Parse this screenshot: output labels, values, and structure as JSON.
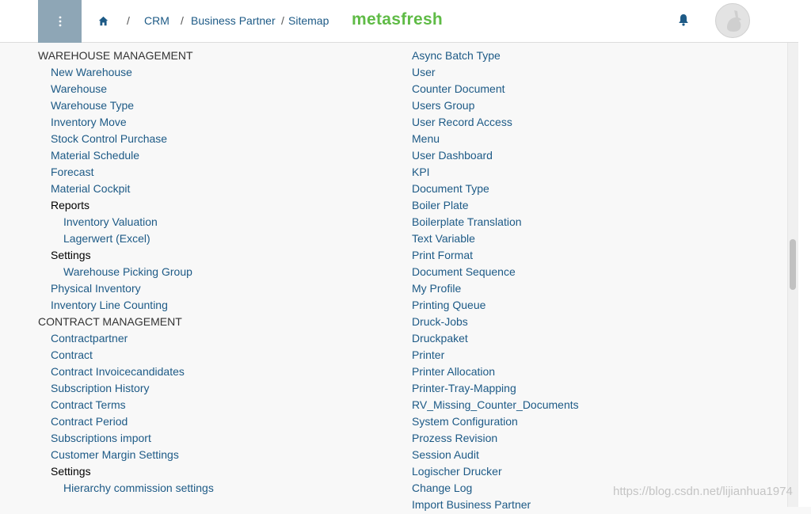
{
  "header": {
    "breadcrumb": [
      "CRM",
      "Business Partner",
      "Sitemap"
    ],
    "separator": "/",
    "logo": "metasfresh",
    "icons": {
      "menu": "kebab-menu-icon",
      "home": "home-icon",
      "notifications": "bell-icon",
      "avatar": "avatar-icon"
    }
  },
  "sitemap": {
    "left": [
      {
        "kind": "section",
        "label": "WAREHOUSE MANAGEMENT",
        "level": 0
      },
      {
        "kind": "item",
        "label": "New Warehouse",
        "level": 1
      },
      {
        "kind": "item",
        "label": "Warehouse",
        "level": 1
      },
      {
        "kind": "item",
        "label": "Warehouse Type",
        "level": 1
      },
      {
        "kind": "item",
        "label": "Inventory Move",
        "level": 1
      },
      {
        "kind": "item",
        "label": "Stock Control Purchase",
        "level": 1
      },
      {
        "kind": "item",
        "label": "Material Schedule",
        "level": 1
      },
      {
        "kind": "item",
        "label": "Forecast",
        "level": 1
      },
      {
        "kind": "item",
        "label": "Material Cockpit",
        "level": 1
      },
      {
        "kind": "category",
        "label": "Reports",
        "level": 1
      },
      {
        "kind": "item",
        "label": "Inventory Valuation",
        "level": 2
      },
      {
        "kind": "item",
        "label": "Lagerwert (Excel)",
        "level": 2
      },
      {
        "kind": "category",
        "label": "Settings",
        "level": 1
      },
      {
        "kind": "item",
        "label": "Warehouse Picking Group",
        "level": 2
      },
      {
        "kind": "item",
        "label": "Physical Inventory",
        "level": 1
      },
      {
        "kind": "item",
        "label": "Inventory Line Counting",
        "level": 1
      },
      {
        "kind": "section",
        "label": "CONTRACT MANAGEMENT",
        "level": 0
      },
      {
        "kind": "item",
        "label": "Contractpartner",
        "level": 1
      },
      {
        "kind": "item",
        "label": "Contract",
        "level": 1
      },
      {
        "kind": "item",
        "label": "Contract Invoicecandidates",
        "level": 1
      },
      {
        "kind": "item",
        "label": "Subscription History",
        "level": 1
      },
      {
        "kind": "item",
        "label": "Contract Terms",
        "level": 1
      },
      {
        "kind": "item",
        "label": "Contract Period",
        "level": 1
      },
      {
        "kind": "item",
        "label": "Subscriptions import",
        "level": 1
      },
      {
        "kind": "item",
        "label": "Customer Margin Settings",
        "level": 1
      },
      {
        "kind": "category",
        "label": "Settings",
        "level": 1
      },
      {
        "kind": "item",
        "label": "Hierarchy commission settings",
        "level": 2
      }
    ],
    "right": [
      {
        "kind": "item",
        "label": "Async Batch Type",
        "level": 0
      },
      {
        "kind": "item",
        "label": "User",
        "level": 0
      },
      {
        "kind": "item",
        "label": "Counter Document",
        "level": 0
      },
      {
        "kind": "item",
        "label": "Users Group",
        "level": 0
      },
      {
        "kind": "item",
        "label": "User Record Access",
        "level": 0
      },
      {
        "kind": "item",
        "label": "Menu",
        "level": 0
      },
      {
        "kind": "item",
        "label": "User Dashboard",
        "level": 0
      },
      {
        "kind": "item",
        "label": "KPI",
        "level": 0
      },
      {
        "kind": "item",
        "label": "Document Type",
        "level": 0
      },
      {
        "kind": "item",
        "label": "Boiler Plate",
        "level": 0
      },
      {
        "kind": "item",
        "label": "Boilerplate Translation",
        "level": 0
      },
      {
        "kind": "item",
        "label": "Text Variable",
        "level": 0
      },
      {
        "kind": "item",
        "label": "Print Format",
        "level": 0
      },
      {
        "kind": "item",
        "label": "Document Sequence",
        "level": 0
      },
      {
        "kind": "item",
        "label": "My Profile",
        "level": 0
      },
      {
        "kind": "item",
        "label": "Printing Queue",
        "level": 0
      },
      {
        "kind": "item",
        "label": "Druck-Jobs",
        "level": 0
      },
      {
        "kind": "item",
        "label": "Druckpaket",
        "level": 0
      },
      {
        "kind": "item",
        "label": "Printer",
        "level": 0
      },
      {
        "kind": "item",
        "label": "Printer Allocation",
        "level": 0
      },
      {
        "kind": "item",
        "label": "Printer-Tray-Mapping",
        "level": 0
      },
      {
        "kind": "item",
        "label": "RV_Missing_Counter_Documents",
        "level": 0
      },
      {
        "kind": "item",
        "label": "System Configuration",
        "level": 0
      },
      {
        "kind": "item",
        "label": "Prozess Revision",
        "level": 0
      },
      {
        "kind": "item",
        "label": "Session Audit",
        "level": 0
      },
      {
        "kind": "item",
        "label": "Logischer Drucker",
        "level": 0
      },
      {
        "kind": "item",
        "label": "Change Log",
        "level": 0
      },
      {
        "kind": "item",
        "label": "Import Business Partner",
        "level": 0
      }
    ]
  },
  "watermark": "https://blog.csdn.net/lijianhua1974",
  "colors": {
    "link": "#1d5a86",
    "text": "#333333",
    "logo": "#5fbb46",
    "menu_button": "#8ea6b6"
  }
}
